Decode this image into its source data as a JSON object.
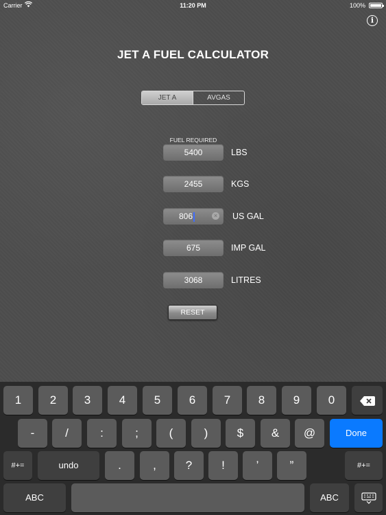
{
  "status_bar": {
    "carrier": "Carrier",
    "time": "11:20 PM",
    "battery": "100%"
  },
  "header": {
    "title": "JET A FUEL CALCULATOR"
  },
  "segment": {
    "options": [
      "JET A",
      "AVGAS"
    ],
    "selected": "JET A"
  },
  "fuel_required_label": "FUEL REQUIRED",
  "rows": [
    {
      "value": "5400",
      "unit": "LBS"
    },
    {
      "value": "2455",
      "unit": "KGS"
    },
    {
      "value": "806",
      "unit": "US GAL"
    },
    {
      "value": "675",
      "unit": "IMP GAL"
    },
    {
      "value": "3068",
      "unit": "LITRES"
    }
  ],
  "reset_label": "RESET",
  "keyboard": {
    "row1": [
      "1",
      "2",
      "3",
      "4",
      "5",
      "6",
      "7",
      "8",
      "9",
      "0"
    ],
    "row2": [
      "-",
      "/",
      ":",
      ";",
      "(",
      ")",
      "$",
      "&",
      "@"
    ],
    "done": "Done",
    "row3_left": "#+=",
    "undo": "undo",
    "row3": [
      ".",
      ",",
      "?",
      "!",
      "’",
      "”"
    ],
    "row3_right": "#+=",
    "abc_left": "ABC",
    "abc_right": "ABC"
  },
  "colors": {
    "accent": "#0a7aff",
    "background": "#4d4d4d",
    "keyboard": "#2b2b2b"
  }
}
